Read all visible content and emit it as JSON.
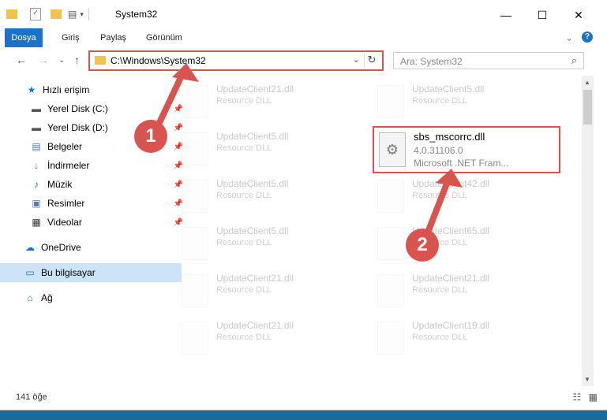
{
  "window": {
    "title": "System32",
    "minimize": "—",
    "maximize": "☐",
    "close": "✕"
  },
  "ribbon": {
    "tabs": [
      "Dosya",
      "Giriş",
      "Paylaş",
      "Görünüm"
    ],
    "expand": "⌄",
    "help": "?"
  },
  "nav": {
    "back": "←",
    "forward": "→",
    "recent": "⌄",
    "up": "↑"
  },
  "address": {
    "path": "C:\\Windows\\System32",
    "dropdown": "⌄",
    "refresh": "↻"
  },
  "search": {
    "placeholder": "Ara: System32",
    "icon": "⌕"
  },
  "sidebar": {
    "items": [
      {
        "label": "Hızlı erişim",
        "icon": "star-icon",
        "glyph": "★",
        "color": "#1a73c8",
        "pin": ""
      },
      {
        "label": "Yerel Disk (C:)",
        "icon": "drive-icon",
        "glyph": "▬",
        "color": "#555555",
        "pin": "📌"
      },
      {
        "label": "Yerel Disk (D:)",
        "icon": "drive-icon",
        "glyph": "▬",
        "color": "#555555",
        "pin": "📌"
      },
      {
        "label": "Belgeler",
        "icon": "documents-icon",
        "glyph": "▤",
        "color": "#4a7ab5",
        "pin": "📌"
      },
      {
        "label": "İndirmeler",
        "icon": "download-icon",
        "glyph": "↓",
        "color": "#1a73c8",
        "pin": "📌"
      },
      {
        "label": "Müzik",
        "icon": "music-icon",
        "glyph": "♪",
        "color": "#1a73c8",
        "pin": "📌"
      },
      {
        "label": "Resimler",
        "icon": "pictures-icon",
        "glyph": "▣",
        "color": "#4a7ab5",
        "pin": "📌"
      },
      {
        "label": "Videolar",
        "icon": "videos-icon",
        "glyph": "▦",
        "color": "#333333",
        "pin": "📌"
      },
      {
        "label": "OneDrive",
        "icon": "cloud-icon",
        "glyph": "☁",
        "color": "#1a73c8",
        "pin": ""
      },
      {
        "label": "Bu bilgisayar",
        "icon": "computer-icon",
        "glyph": "▭",
        "color": "#1a73c8",
        "pin": ""
      },
      {
        "label": "Ağ",
        "icon": "network-icon",
        "glyph": "⌂",
        "color": "#1a73c8",
        "pin": ""
      }
    ]
  },
  "files": [
    {
      "name": "UpdateClient21.dll",
      "desc": "Resource DLL"
    },
    {
      "name": "UpdateClient5.dll",
      "desc": "Resource DLL"
    },
    {
      "name": "UpdateClient5.dll",
      "desc": "Resource DLL"
    },
    {
      "name": "UpdateClient5.dll",
      "desc": "Resource DLL"
    },
    {
      "name": "UpdateClient42.dll",
      "desc": "Resource DLL"
    },
    {
      "name": "UpdateClient5.dll",
      "desc": "Resource DLL"
    },
    {
      "name": "UpdateClient65.dll",
      "desc": "Resource DLL"
    },
    {
      "name": "UpdateClient21.dll",
      "desc": "Resource DLL"
    },
    {
      "name": "UpdateClient21.dll",
      "desc": "Resource DLL"
    },
    {
      "name": "UpdateClient21.dll",
      "desc": "Resource DLL"
    },
    {
      "name": "UpdateClient19.dll",
      "desc": "Resource DLL"
    }
  ],
  "highlighted_file": {
    "name": "sbs_mscorrc.dll",
    "version": "4.0.31106.0",
    "desc": "Microsoft .NET Fram..."
  },
  "annotations": {
    "step1": "1",
    "step2": "2",
    "color": "#d9534f"
  },
  "status": {
    "count": "141 öğe"
  }
}
